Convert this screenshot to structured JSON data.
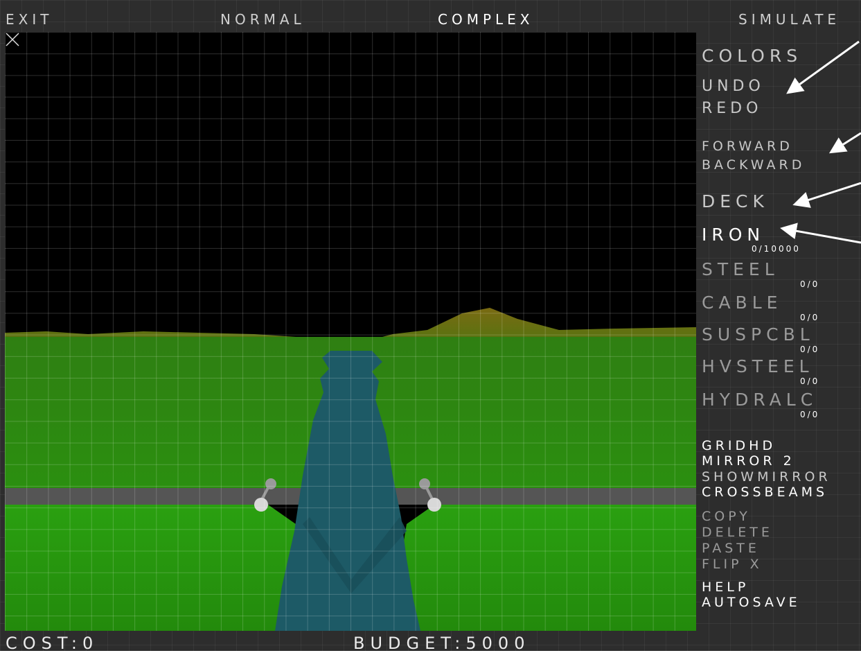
{
  "topbar": {
    "exit": "EXIT",
    "normal": "NORMAL",
    "complex": "COMPLEX",
    "simulate": "SIMULATE"
  },
  "sidebar": {
    "colors": "COLORS",
    "undo": "UNDO",
    "redo": "REDO",
    "forward": "FORWARD",
    "backward": "BACKWARD",
    "deck": "DECK",
    "iron": "IRON",
    "iron_count": "0/10000",
    "steel": "STEEL",
    "steel_count": "0/0",
    "cable": "CABLE",
    "cable_count": "0/0",
    "suspcbl": "SUSPCBL",
    "suspcbl_count": "0/0",
    "hvsteel": "HVSTEEL",
    "hvsteel_count": "0/0",
    "hydralc": "HYDRALC",
    "hydralc_count": "0/0",
    "gridhd": "GRIDHD",
    "mirror": "MIRROR 2",
    "showmirror": "SHOWMIRROR",
    "crossbeams": "CROSSBEAMS",
    "copy": "COPY",
    "delete": "DELETE",
    "paste": "PASTE",
    "flipx": "FLIP X",
    "help": "HELP",
    "autosave": "AUTOSAVE"
  },
  "status": {
    "cost": "COST:0",
    "budget": "BUDGET:5000"
  },
  "colors": {
    "sky": "#000000",
    "grass": "#2a9a12",
    "water": "#1d5a66",
    "road": "#555555",
    "panel": "#2d2d2d"
  }
}
